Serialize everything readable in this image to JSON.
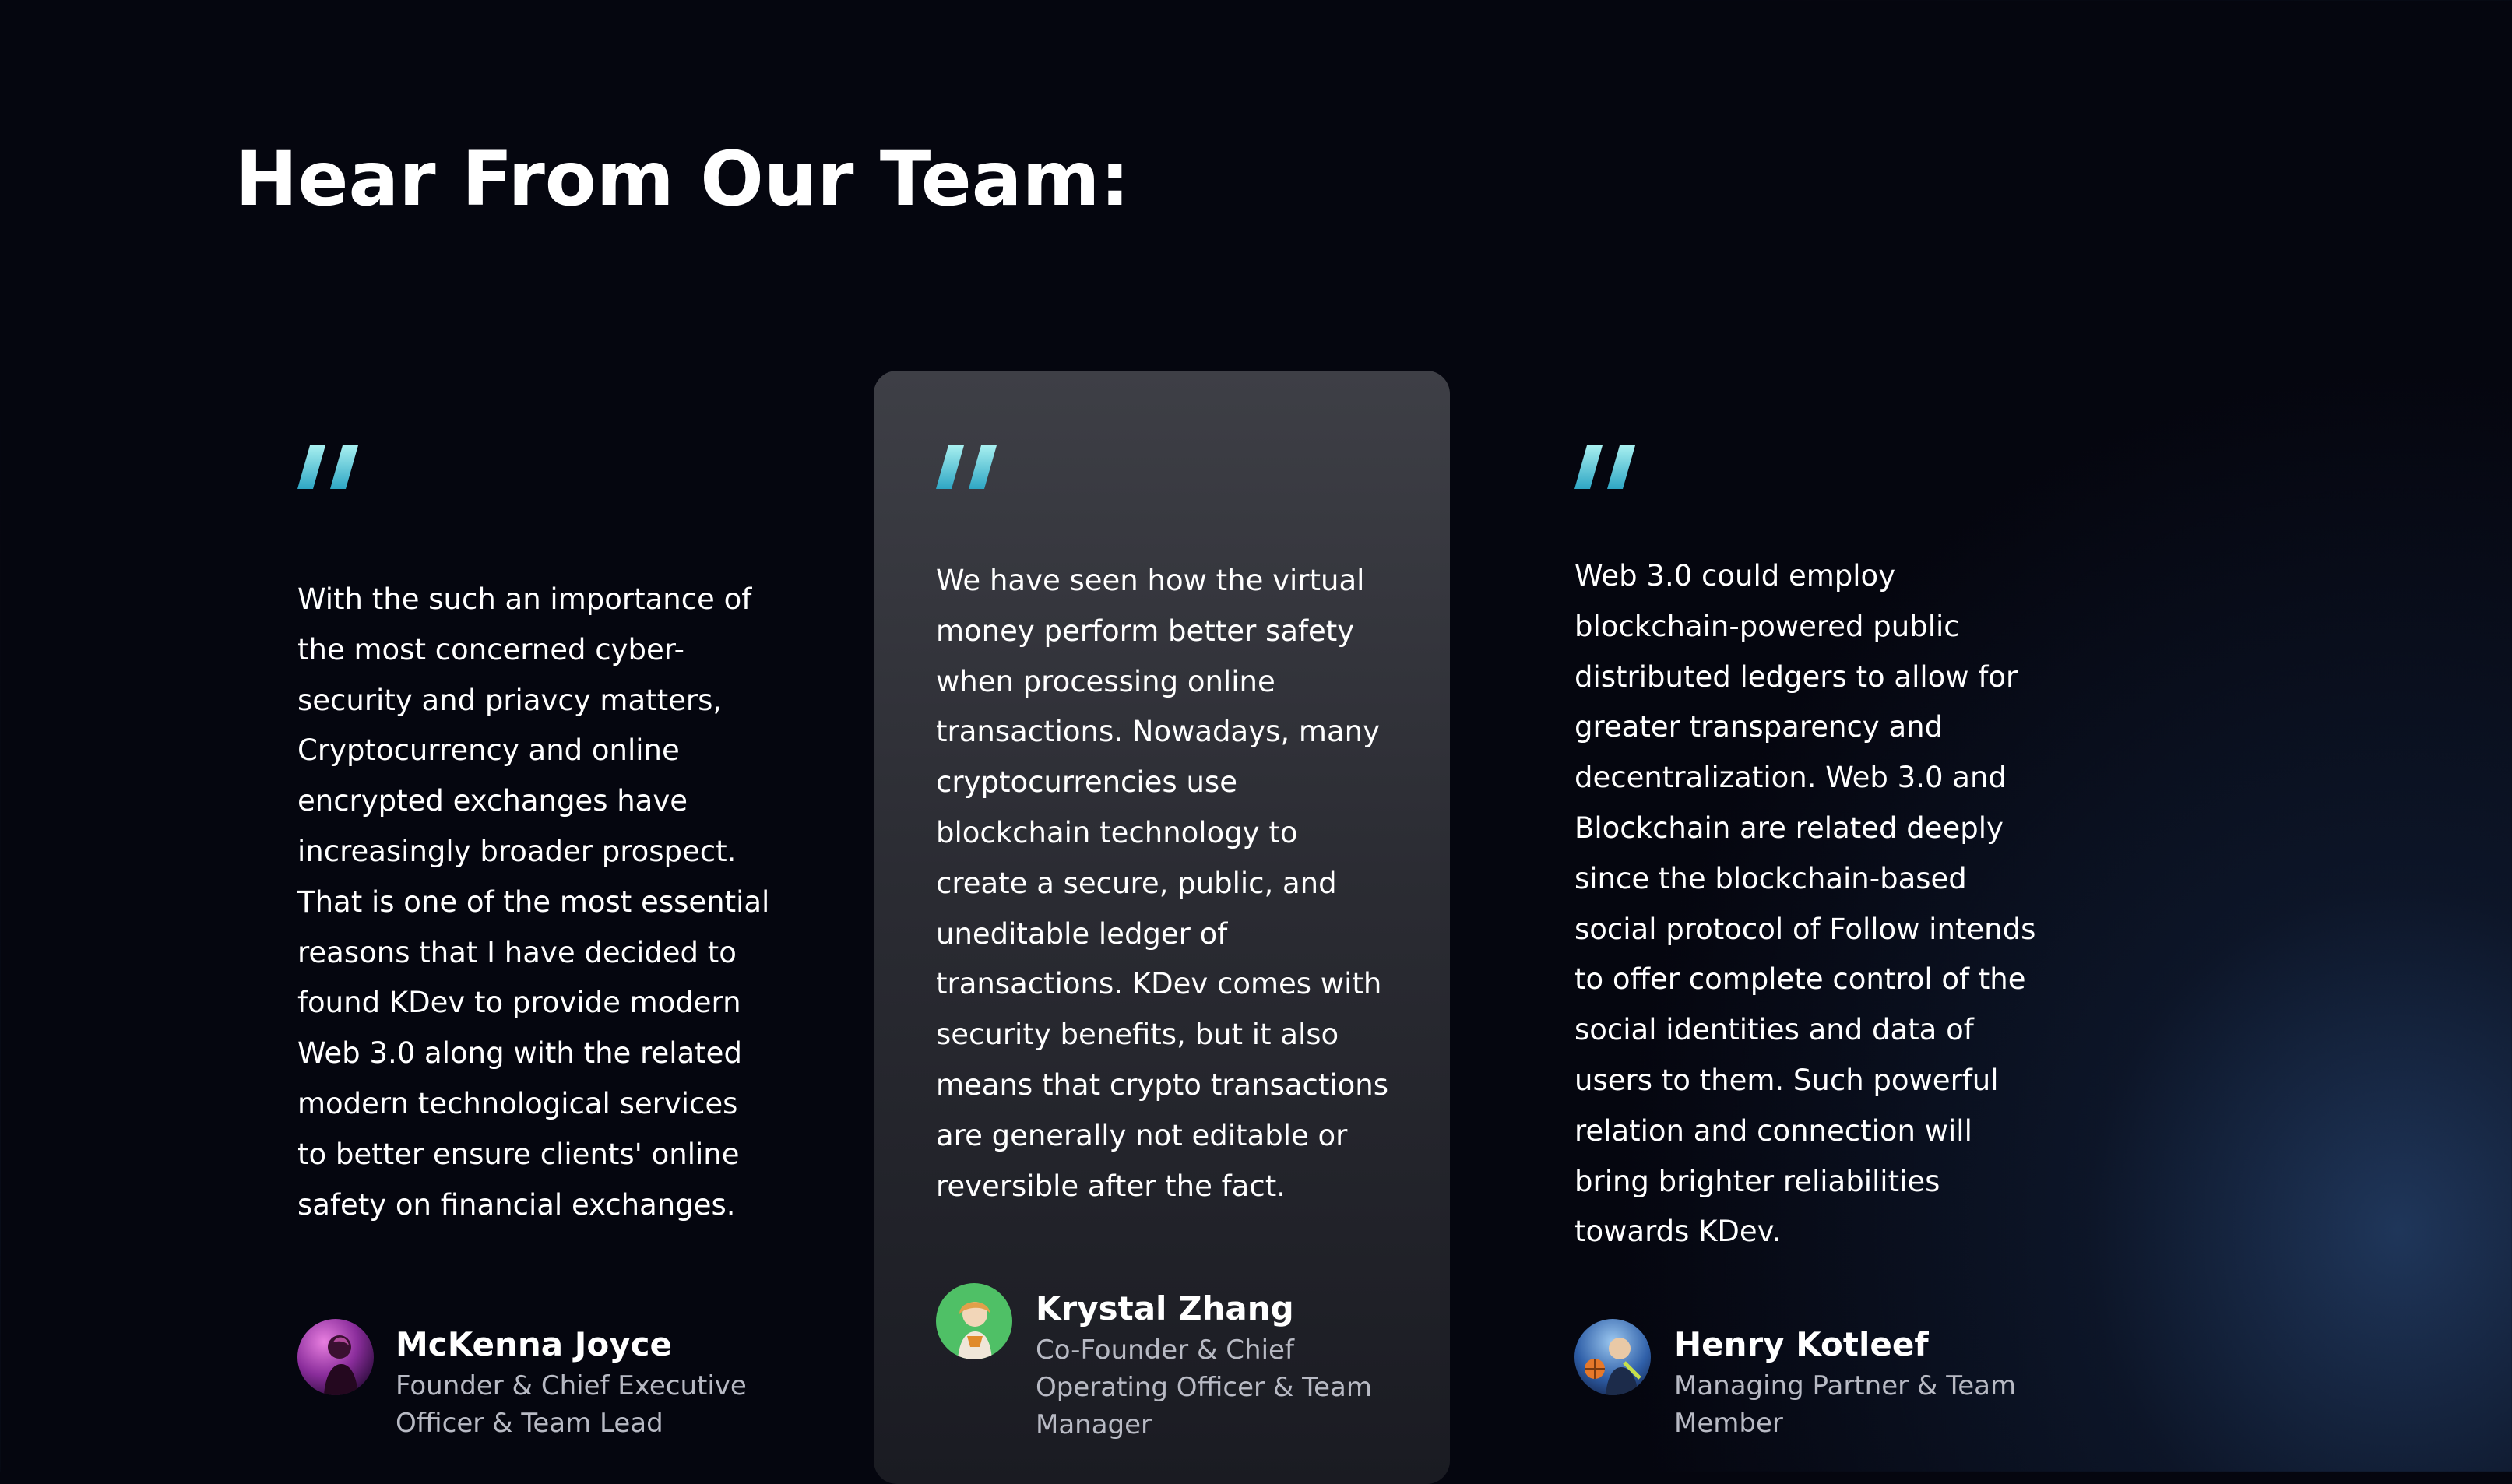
{
  "section": {
    "title": "Hear From Our Team:"
  },
  "colors": {
    "accent_gradient_start": "#a8f0f0",
    "accent_gradient_end": "#2ea6c4",
    "card_highlight": "#3e3f46",
    "background": "#05060f",
    "role_text": "#b8bac4"
  },
  "testimonials": [
    {
      "quote_icon": "quote-mark-icon",
      "quote_lines": [
        "With the such an importance of",
        "the most concerned cyber-",
        "security and priavcy matters,",
        "Cryptocurrency and online",
        "encrypted exchanges have",
        "increasingly broader prospect.",
        "That is one of the most essential",
        "reasons that I have decided to",
        "found KDev to provide modern",
        "Web 3.0 along with the related",
        "modern technological services",
        "to better ensure clients' online",
        "safety on financial exchanges."
      ],
      "name": "McKenna Joyce",
      "role_lines": [
        "Founder & Chief Executive",
        "Officer & Team Lead"
      ],
      "avatar_icon": "avatar-purple-portrait"
    },
    {
      "quote_icon": "quote-mark-icon",
      "quote_lines": [
        "We have seen how the virtual",
        "money perform better safety",
        "when processing online",
        "transactions. Nowadays, many",
        "cryptocurrencies use",
        "blockchain technology to",
        "create a secure, public, and",
        "uneditable ledger of",
        "transactions. KDev comes with",
        "security benefits, but it also",
        "means that crypto transactions",
        "are generally not editable or",
        "reversible after the fact."
      ],
      "name": "Krystal Zhang",
      "role_lines": [
        "Co-Founder & Chief",
        "Operating Officer & Team",
        "Manager"
      ],
      "avatar_icon": "avatar-green-portrait"
    },
    {
      "quote_icon": "quote-mark-icon",
      "quote_lines": [
        "Web 3.0 could employ",
        "blockchain-powered public",
        "distributed ledgers to allow for",
        "greater transparency and",
        "decentralization. Web 3.0 and",
        "Blockchain are related deeply",
        "since the blockchain-based",
        "social protocol of Follow intends",
        "to offer complete control of the",
        "social identities and data of",
        "users to them. Such powerful",
        "relation and connection will",
        "bring brighter reliabilities",
        "towards KDev."
      ],
      "name": "Henry Kotleef",
      "role_lines": [
        "Managing Partner & Team",
        "Member"
      ],
      "avatar_icon": "avatar-blue-portrait"
    }
  ]
}
